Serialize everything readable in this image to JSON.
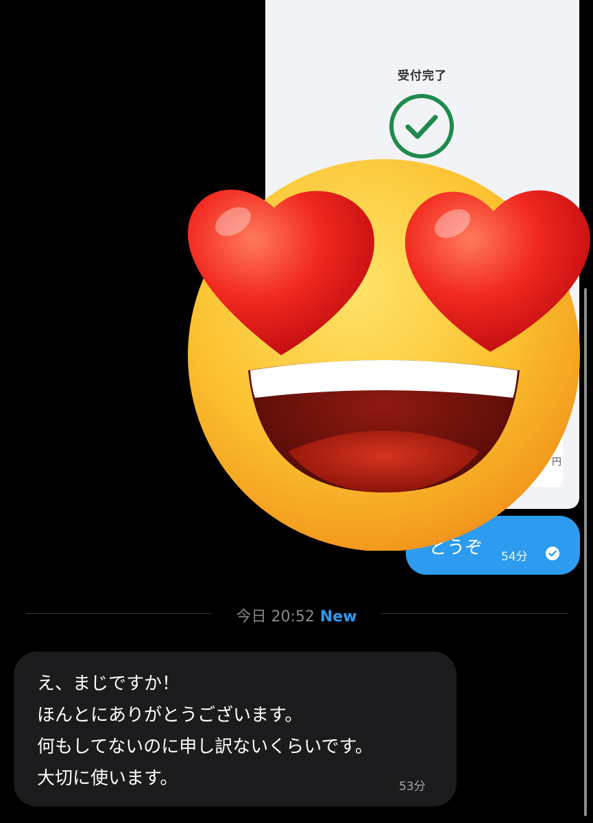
{
  "receipt": {
    "title": "受付完了",
    "amount_suffix": "円"
  },
  "outgoing_message": {
    "text": "どうぞ",
    "time": "54分",
    "status_icon": "read-check-icon"
  },
  "divider": {
    "date": "今日 20:52",
    "badge": "New"
  },
  "incoming_message": {
    "lines": [
      "え、まじですか！",
      "ほんとにありがとうございます。",
      "何もしてないのに申し訳ないくらいです。",
      "大切に使います。"
    ],
    "time": "53分"
  },
  "overlay": {
    "icon": "heart-eyes-emoji-icon"
  },
  "colors": {
    "background": "#000000",
    "outgoing_bubble": "#2d9bf0",
    "incoming_bubble": "#1c1c1e",
    "accent_new": "#2d9bf0",
    "check_green": "#1f8a4c"
  }
}
